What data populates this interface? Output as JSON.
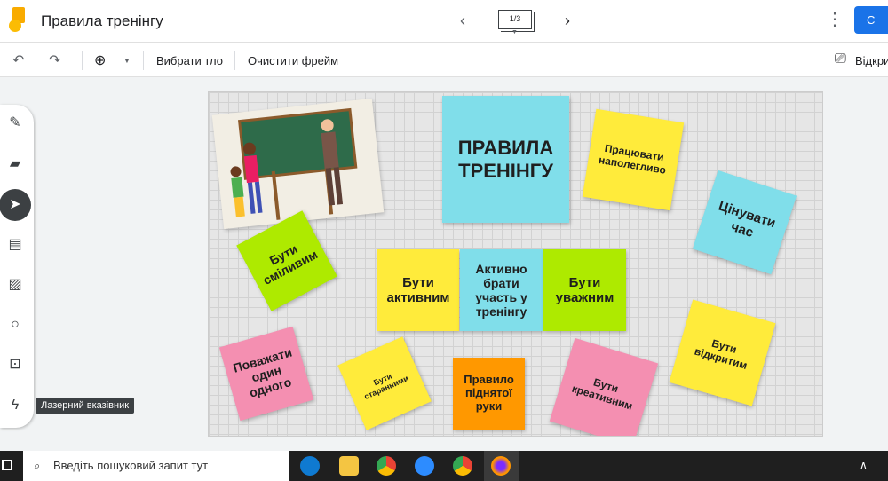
{
  "app": {
    "title": "Правила тренінгу",
    "frame_indicator": "1/3",
    "share_label": "С"
  },
  "toolbar": {
    "set_background": "Вибрати тло",
    "clear_frame": "Очистити фрейм",
    "open_label": "Відкри"
  },
  "sidebar": {
    "tooltip": "Лазерний вказівник"
  },
  "notes": [
    {
      "text": "ПРАВИЛА ТРЕНІНГУ",
      "color": "#80deea"
    },
    {
      "text": "Працювати наполегливо",
      "color": "#ffeb3b"
    },
    {
      "text": "Цінувати час",
      "color": "#80deea"
    },
    {
      "text": "Бути сміливим",
      "color": "#aeea00"
    },
    {
      "text": "Бути активним",
      "color": "#ffeb3b"
    },
    {
      "text": "Активно брати участь у тренінгу",
      "color": "#80deea"
    },
    {
      "text": "Бути уважним",
      "color": "#aeea00"
    },
    {
      "text": "Поважати один одного",
      "color": "#f48fb1"
    },
    {
      "text": "Бути старанними",
      "color": "#ffeb3b"
    },
    {
      "text": "Правило піднятої руки",
      "color": "#ff9800"
    },
    {
      "text": "Бути креативним",
      "color": "#f48fb1"
    },
    {
      "text": "Бути відкритим",
      "color": "#ffeb3b"
    }
  ],
  "taskbar": {
    "search_placeholder": "Введіть пошуковий запит тут"
  }
}
